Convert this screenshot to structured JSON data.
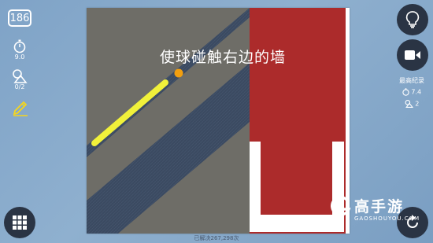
{
  "level": "186",
  "stats": {
    "timer_value": "9.0",
    "shapes_value": "0/2"
  },
  "instruction": "使球碰触右边的墙",
  "best_record": {
    "label": "最高纪录",
    "time": "7.4",
    "shapes": "2"
  },
  "solved_count": "已解决267,298次",
  "watermark": {
    "brand": "高手游",
    "domain": "GAOSHOUYOU.COM"
  },
  "colors": {
    "board_gray": "#6e6d67",
    "stripe_blue": "#3b4a61",
    "wall_red": "#ac2b2b",
    "line_yellow": "#f1f13a",
    "ball_orange": "#f29f10",
    "button_dark": "#2a3444",
    "pencil_yellow": "#f5d61d"
  },
  "icons": [
    "stopwatch-icon",
    "shapes-icon",
    "pencil-icon",
    "lightbulb-icon",
    "video-camera-icon",
    "grid-menu-icon",
    "restart-icon"
  ]
}
